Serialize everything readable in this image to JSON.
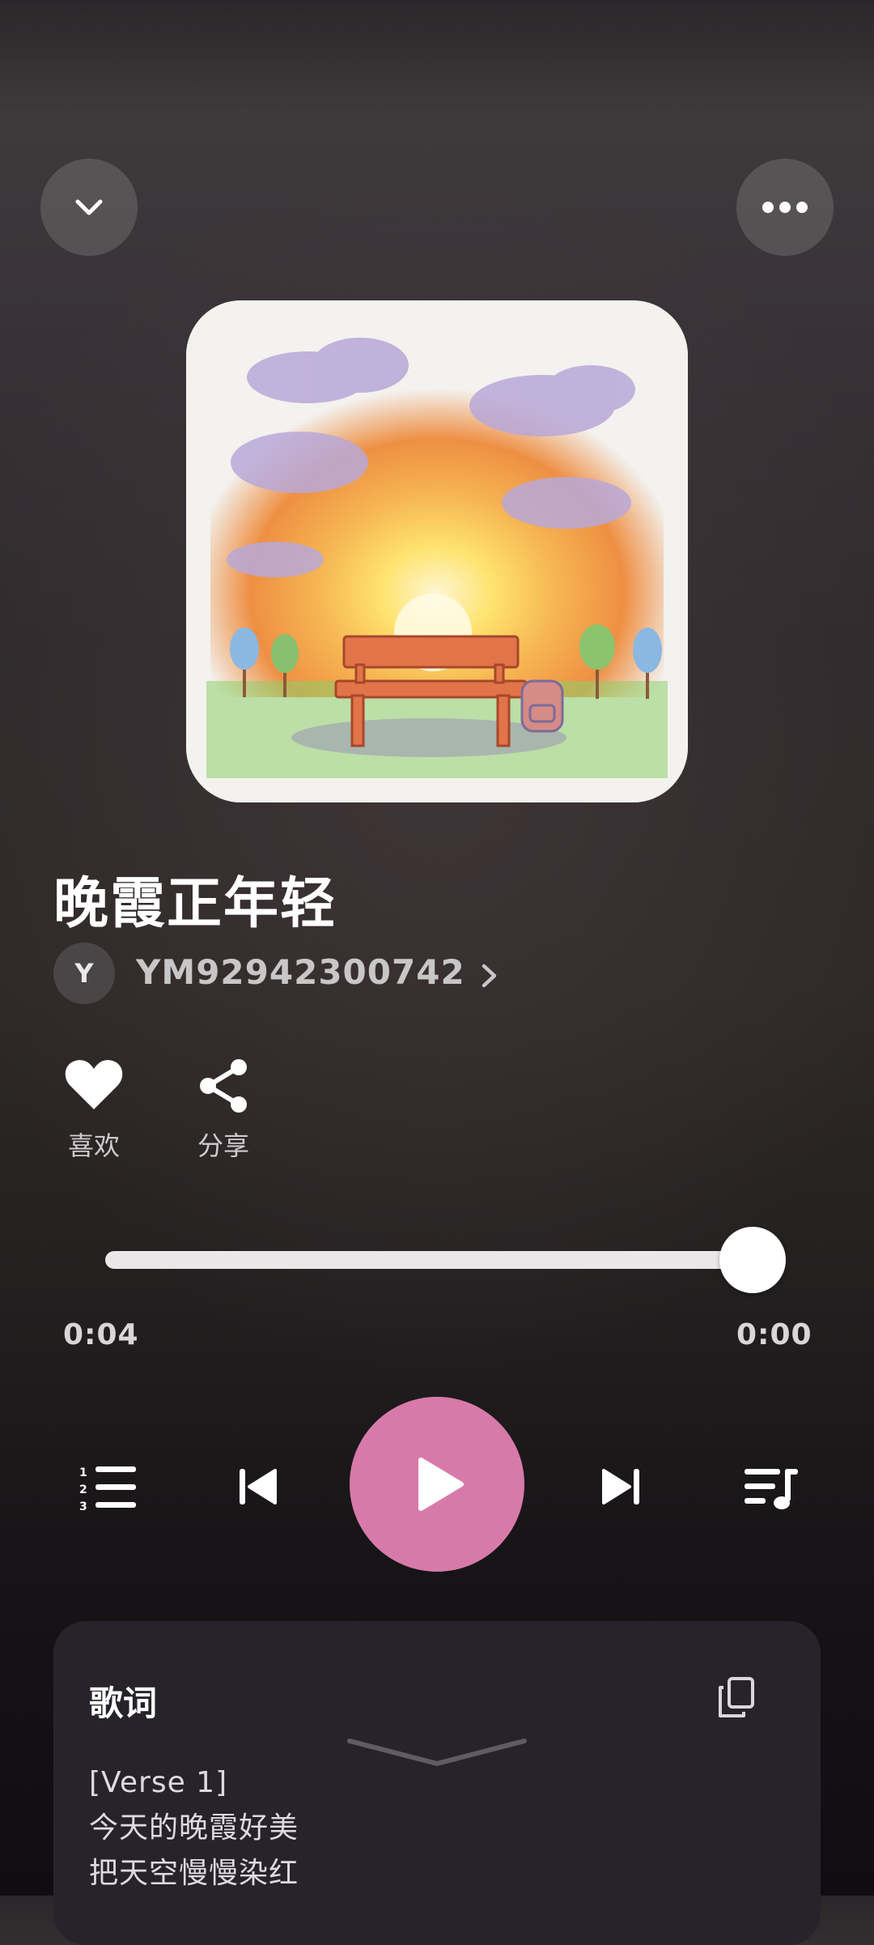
{
  "header": {
    "collapse_icon": "chevron-down-icon",
    "more_icon": "more-horizontal-icon"
  },
  "song": {
    "title": "晚霞正年轻",
    "artist_initial": "Y",
    "artist_name": "YM92942300742"
  },
  "actions": {
    "like_label": "喜欢",
    "share_label": "分享"
  },
  "progress": {
    "elapsed": "0:04",
    "total": "0:00",
    "fraction": 1.0
  },
  "controls": {
    "playlist_icon": "numbered-list-icon",
    "prev_icon": "skip-previous-icon",
    "play_icon": "play-icon",
    "next_icon": "skip-next-icon",
    "queue_icon": "music-queue-icon",
    "accent_color": "#d77aa9"
  },
  "lyrics": {
    "heading": "歌词",
    "lines": [
      "[Verse 1]",
      "今天的晚霞好美",
      "把天空慢慢染红"
    ]
  }
}
